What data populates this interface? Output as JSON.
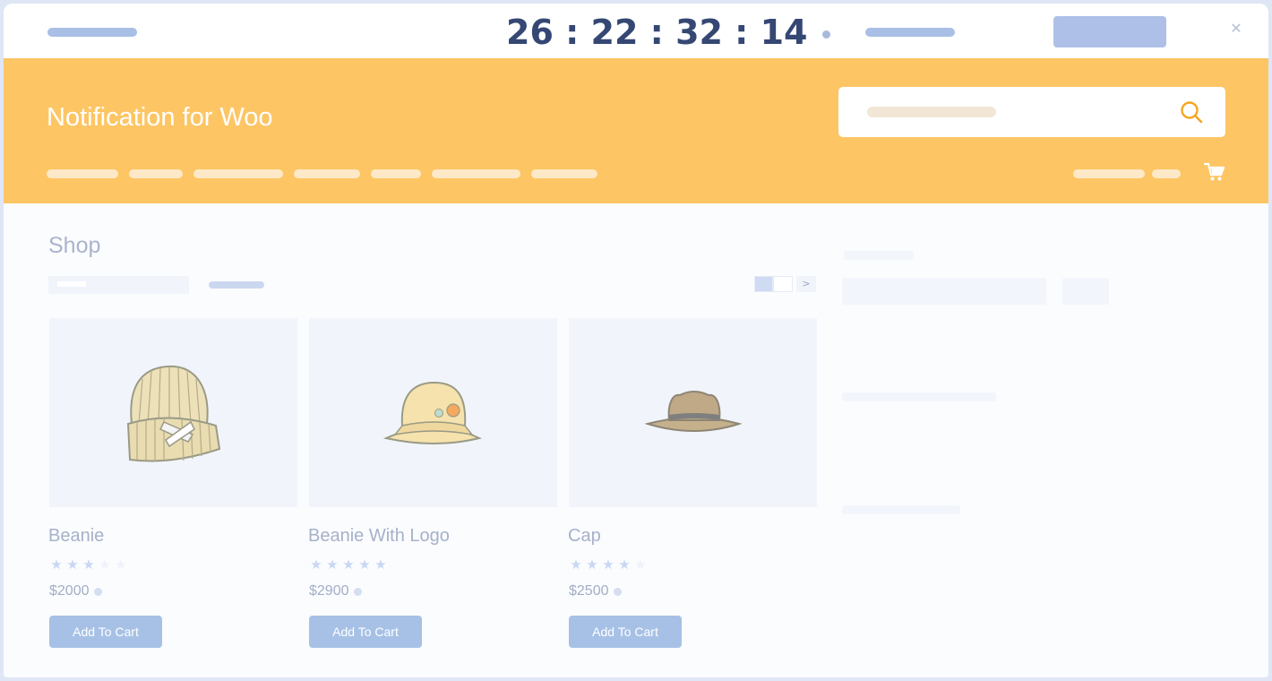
{
  "countdown": {
    "text": "26 : 22 : 32 : 14"
  },
  "header": {
    "site_title": "Notification for Woo"
  },
  "shop": {
    "title": "Shop",
    "pager_next": ">"
  },
  "products": [
    {
      "name": "Beanie",
      "price": "$2000",
      "rating": 3,
      "button": "Add To Cart"
    },
    {
      "name": "Beanie With Logo",
      "price": "$2900",
      "rating": 5,
      "button": "Add To Cart"
    },
    {
      "name": "Cap",
      "price": "$2500",
      "rating": 4,
      "button": "Add To Cart"
    }
  ],
  "icons": {
    "close": "close-icon",
    "search": "search-icon",
    "cart": "cart-icon",
    "star": "star-icon"
  },
  "colors": {
    "header_bg": "#fdc564",
    "countdown": "#354773",
    "button": "#a7c1e6",
    "search_icon": "#f5a623"
  }
}
